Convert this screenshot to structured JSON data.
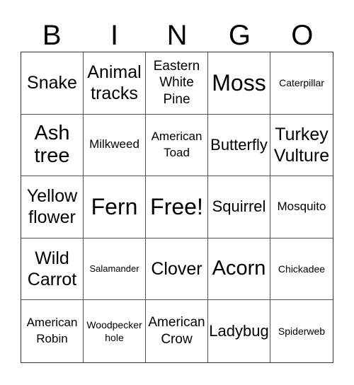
{
  "header": {
    "letters": [
      "B",
      "I",
      "N",
      "G",
      "O"
    ]
  },
  "cells": [
    {
      "text": "Snake",
      "size": "ml"
    },
    {
      "text": "Animal tracks",
      "size": "ml"
    },
    {
      "text": "Eastern White Pine",
      "size": "sm"
    },
    {
      "text": "Moss",
      "size": "xl"
    },
    {
      "text": "Caterpillar",
      "size": "xs"
    },
    {
      "text": "Ash tree",
      "size": "l"
    },
    {
      "text": "Milkweed",
      "size": "s"
    },
    {
      "text": "American Toad",
      "size": "s"
    },
    {
      "text": "Butterfly",
      "size": "m"
    },
    {
      "text": "Turkey Vulture",
      "size": "ml"
    },
    {
      "text": "Yellow flower",
      "size": "ml"
    },
    {
      "text": "Fern",
      "size": "xl"
    },
    {
      "text": "Free!",
      "size": "xl"
    },
    {
      "text": "Squirrel",
      "size": "m"
    },
    {
      "text": "Mosquito",
      "size": "s"
    },
    {
      "text": "Wild Carrot",
      "size": "ml"
    },
    {
      "text": "Salamander",
      "size": "xxs"
    },
    {
      "text": "Clover",
      "size": "ml"
    },
    {
      "text": "Acorn",
      "size": "l"
    },
    {
      "text": "Chickadee",
      "size": "xs"
    },
    {
      "text": "American Robin",
      "size": "s"
    },
    {
      "text": "Woodpecker hole",
      "size": "xs"
    },
    {
      "text": "American Crow",
      "size": "sm"
    },
    {
      "text": "Ladybug",
      "size": "m"
    },
    {
      "text": "Spiderweb",
      "size": "xs"
    }
  ]
}
